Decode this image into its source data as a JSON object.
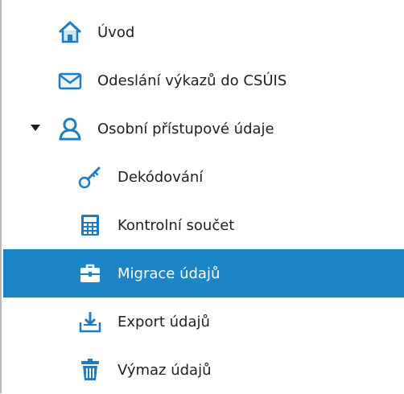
{
  "tree": {
    "items": [
      {
        "label": "Úvod",
        "icon": "home-icon",
        "level": 0
      },
      {
        "label": "Odeslání výkazů do CSÚIS",
        "icon": "envelope-icon",
        "level": 0
      },
      {
        "label": "Osobní přístupové údaje",
        "icon": "user-icon",
        "level": 0,
        "expanded": true
      },
      {
        "label": "Dekódování",
        "icon": "key-icon",
        "level": 1
      },
      {
        "label": "Kontrolní součet",
        "icon": "calculator-icon",
        "level": 1
      },
      {
        "label": "Migrace údajů",
        "icon": "briefcase-icon",
        "level": 1,
        "selected": true
      },
      {
        "label": "Export údajů",
        "icon": "export-icon",
        "level": 1
      },
      {
        "label": "Výmaz údajů",
        "icon": "trash-icon",
        "level": 1
      }
    ]
  },
  "colors": {
    "selection": "#1c85c7",
    "icon_blue": "#1f7cc2",
    "text": "#1f1f1f"
  }
}
